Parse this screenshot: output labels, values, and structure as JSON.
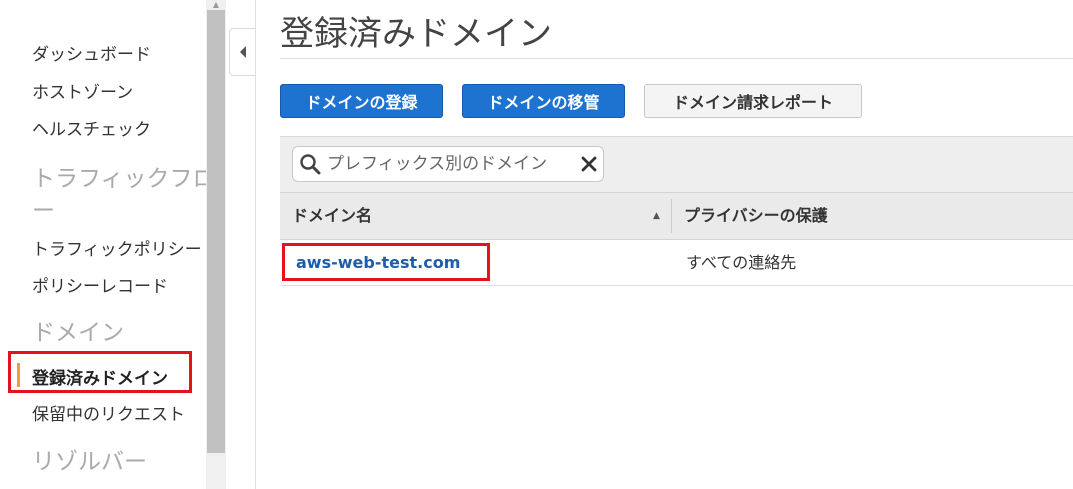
{
  "sidebar": {
    "items": [
      {
        "label": "ダッシュボード"
      },
      {
        "label": "ホストゾーン"
      },
      {
        "label": "ヘルスチェック"
      }
    ],
    "traffic_flow_header": "トラフィックフロー",
    "traffic_flow_header_line1": "トラフィックフロ",
    "traffic_flow_header_line2": "ー",
    "traffic_items": [
      {
        "label": "トラフィックポリシー"
      },
      {
        "label": "ポリシーレコード"
      }
    ],
    "domains_header": "ドメイン",
    "domain_items": [
      {
        "label": "登録済みドメイン",
        "active": true
      },
      {
        "label": "保留中のリクエスト"
      }
    ],
    "resolver_header": "リゾルバー",
    "accent_color": "#f0a030"
  },
  "main": {
    "title": "登録済みドメイン",
    "buttons": {
      "register": "ドメインの登録",
      "transfer": "ドメインの移管",
      "billing_report": "ドメイン請求レポート"
    },
    "search": {
      "placeholder": "プレフィックス別のドメイン",
      "value": ""
    },
    "table": {
      "columns": [
        "ドメイン名",
        "プライバシーの保護"
      ],
      "sort": "ascending",
      "rows": [
        {
          "domain": "aws-web-test.com",
          "privacy": "すべての連絡先"
        }
      ]
    },
    "colors": {
      "primary_button": "#1e73d0",
      "link": "#1e5ea8",
      "annotation_highlight": "#e3121b"
    }
  },
  "icons": [
    "collapse-left-icon",
    "search-icon",
    "close-icon",
    "sort-ascending-icon",
    "scroll-up-arrow-icon"
  ]
}
